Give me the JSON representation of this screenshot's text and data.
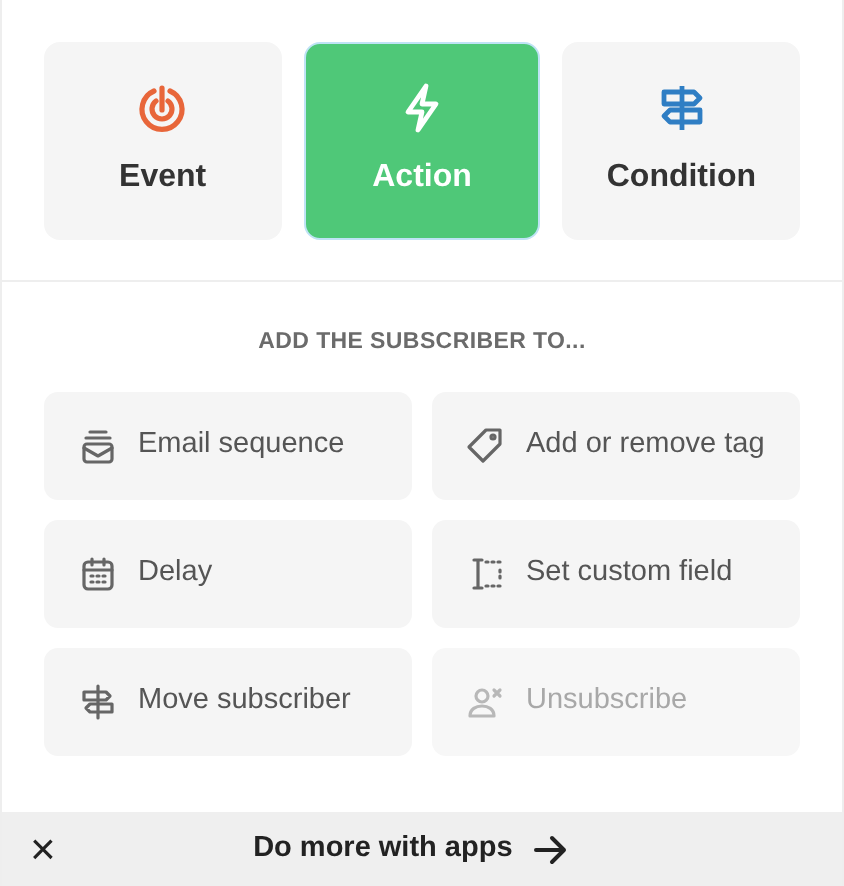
{
  "step_types": [
    {
      "label": "Event",
      "selected": false
    },
    {
      "label": "Action",
      "selected": true
    },
    {
      "label": "Condition",
      "selected": false
    }
  ],
  "section_heading": "ADD THE SUBSCRIBER TO...",
  "actions": [
    {
      "label": "Email sequence",
      "disabled": false
    },
    {
      "label": "Add or remove tag",
      "disabled": false
    },
    {
      "label": "Delay",
      "disabled": false
    },
    {
      "label": "Set custom field",
      "disabled": false
    },
    {
      "label": "Move subscriber",
      "disabled": false
    },
    {
      "label": "Unsubscribe",
      "disabled": true
    }
  ],
  "footer": {
    "close": "×",
    "label": "Do more with apps"
  }
}
